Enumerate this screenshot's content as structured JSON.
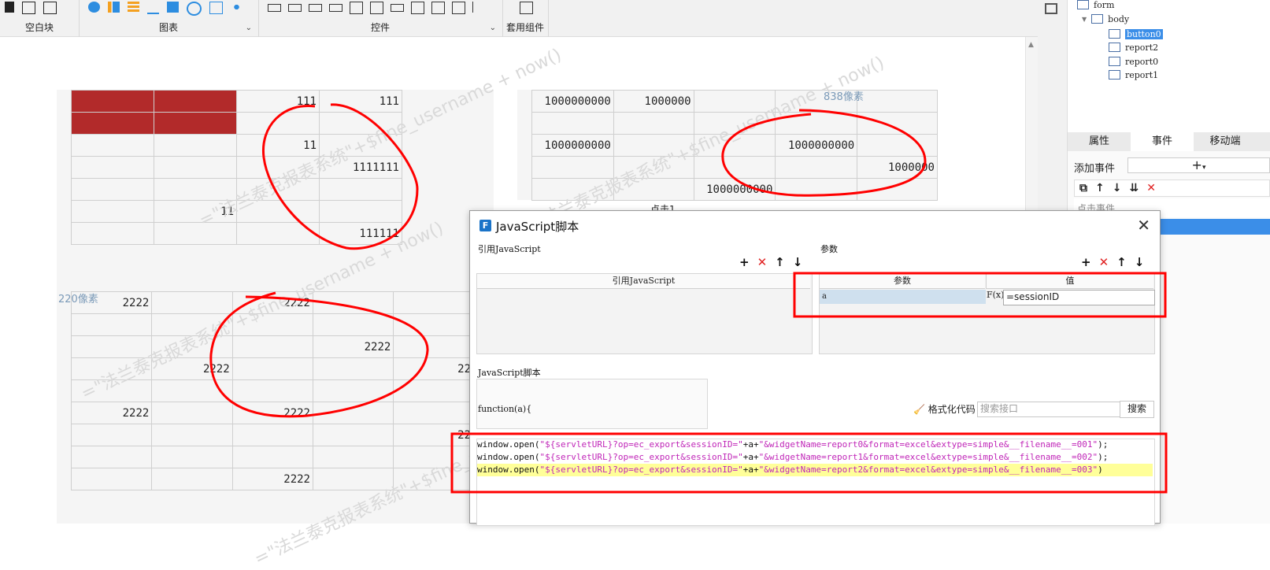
{
  "toolbar": {
    "groups": [
      {
        "label": "空白块"
      },
      {
        "label": "图表"
      },
      {
        "label": "控件"
      },
      {
        "label": "套用组件"
      }
    ]
  },
  "tree": {
    "items": [
      "form",
      "body",
      "button0",
      "report2",
      "report0",
      "report1"
    ]
  },
  "side_tabs": [
    "属性",
    "事件",
    "移动端"
  ],
  "event": {
    "add_label": "添加事件",
    "item": "点击事件"
  },
  "canvas": {
    "label_838": "838像素",
    "label_220": "220像素",
    "label_click": "点击1",
    "watermark": "=\"法兰泰克报表系统\"+$fine_username + now()",
    "report0": {
      "rows": [
        [
          "",
          "",
          "111",
          "111"
        ],
        [
          "",
          "",
          "",
          ""
        ],
        [
          "",
          "",
          "11",
          ""
        ],
        [
          "",
          "",
          "",
          "1111111"
        ],
        [
          "",
          "",
          "",
          ""
        ],
        [
          "",
          "11",
          "",
          ""
        ],
        [
          "",
          "",
          "",
          "111111"
        ]
      ]
    },
    "report1": {
      "rows": [
        [
          "1000000000",
          "1000000",
          "",
          "",
          ""
        ],
        [
          "",
          "",
          "",
          "",
          ""
        ],
        [
          "1000000000",
          "",
          "",
          "1000000000",
          ""
        ],
        [
          "",
          "",
          "",
          "",
          "1000000"
        ],
        [
          "",
          "",
          "1000000000",
          "",
          ""
        ]
      ]
    },
    "report2": {
      "rows": [
        [
          "2222",
          "",
          "2222",
          "",
          ""
        ],
        [
          "",
          "",
          "",
          "",
          ""
        ],
        [
          "",
          "",
          "",
          "2222",
          ""
        ],
        [
          "",
          "2222",
          "",
          "",
          "22"
        ],
        [
          "",
          "",
          "",
          "",
          ""
        ],
        [
          "2222",
          "",
          "2222",
          "",
          ""
        ],
        [
          "",
          "",
          "",
          "",
          "22"
        ],
        [
          "",
          "",
          "",
          "",
          ""
        ],
        [
          "",
          "",
          "2222",
          "",
          ""
        ]
      ]
    }
  },
  "dialog": {
    "title": "JavaScript脚本",
    "ref_section": "引用JavaScript",
    "ref_col": "引用JavaScript",
    "param_section": "参数",
    "param_col": "参数",
    "value_col": "值",
    "param_name": "a",
    "param_fx": "F(x)",
    "param_value": "=sessionID",
    "script_section": "JavaScript脚本",
    "func_sig": "function(a){",
    "format_label": "格式化代码",
    "search_placeholder": "搜索接口",
    "search_button": "搜索",
    "code_lines": [
      {
        "pre": "window.open(",
        "str1": "\"${servletURL}?op=ec_export&sessionID=\"",
        "mid": "+a+",
        "str2": "\"&widgetName=report0&format=excel&extype=simple&__filename__=001\"",
        "post": ");"
      },
      {
        "pre": "window.open(",
        "str1": "\"${servletURL}?op=ec_export&sessionID=\"",
        "mid": "+a+",
        "str2": "\"&widgetName=report1&format=excel&extype=simple&__filename__=002\"",
        "post": ");"
      },
      {
        "pre": "window.open(",
        "str1": "\"${servletURL}?op=ec_export&sessionID=\"",
        "mid": "+a+",
        "str2": "\"&widgetName=report2&format=excel&extype=simple&__filename__=003\"",
        "post": ")"
      }
    ]
  },
  "colors": {
    "accent": "#3b8ee8",
    "red_cell": "#b22a2a",
    "annotation": "#ff0000",
    "string": "#c026b8",
    "highlight": "#ffff99"
  }
}
